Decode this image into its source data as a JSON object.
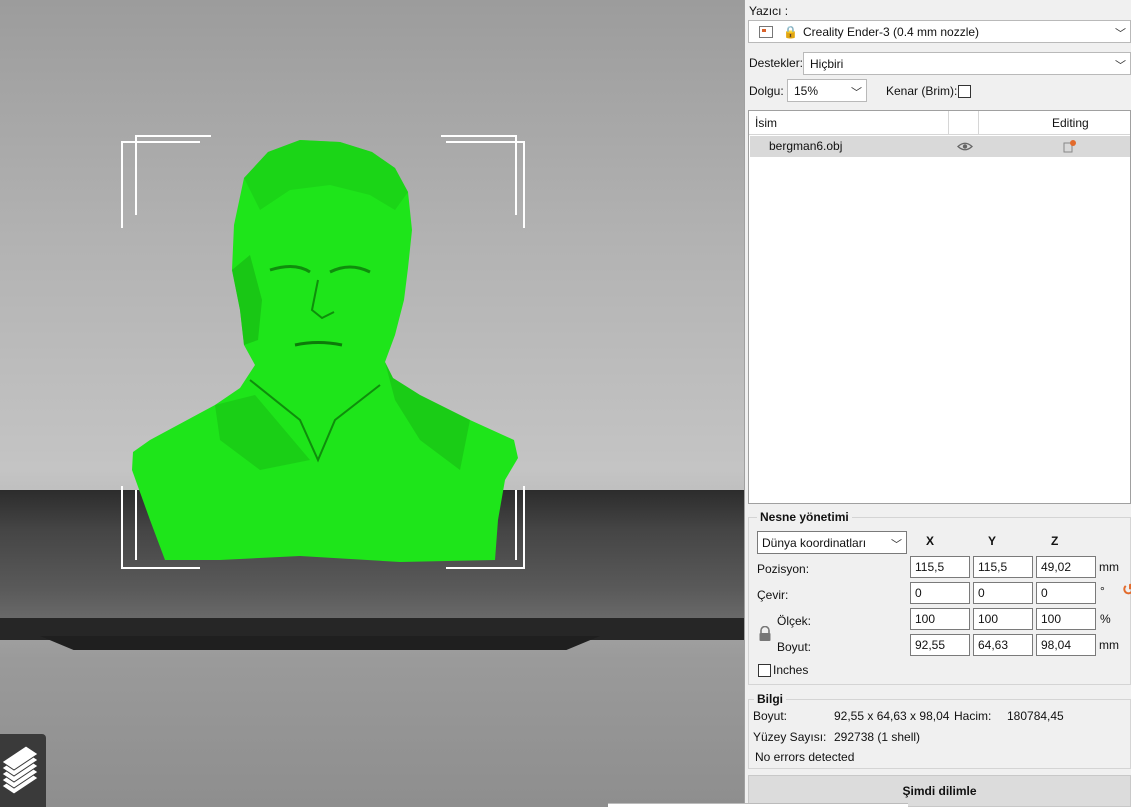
{
  "viewport": {
    "model_color": "#1ee51a"
  },
  "printer": {
    "label": "Yazıcı :",
    "value": "Creality Ender-3 (0.4 mm nozzle)"
  },
  "supports": {
    "label": "Destekler:",
    "value": "Hiçbiri"
  },
  "infill": {
    "label": "Dolgu:",
    "value": "15%"
  },
  "brim": {
    "label": "Kenar (Brim):"
  },
  "object_list": {
    "col_name": "İsim",
    "col_editing": "Editing",
    "rows": [
      {
        "name": "bergman6.obj"
      }
    ]
  },
  "object_manipulation": {
    "title": "Nesne yönetimi",
    "coord_system": "Dünya koordinatları",
    "axes": [
      "X",
      "Y",
      "Z"
    ],
    "position": {
      "label": "Pozisyon:",
      "x": "115,5",
      "y": "115,5",
      "z": "49,02",
      "unit": "mm"
    },
    "rotation": {
      "label": "Çevir:",
      "x": "0",
      "y": "0",
      "z": "0",
      "unit": "°"
    },
    "scale": {
      "label": "Ölçek:",
      "x": "100",
      "y": "100",
      "z": "100",
      "unit": "%"
    },
    "size": {
      "label": "Boyut:",
      "x": "92,55",
      "y": "64,63",
      "z": "98,04",
      "unit": "mm"
    },
    "inches_label": "Inches"
  },
  "info": {
    "title": "Bilgi",
    "size_label": "Boyut:",
    "size_value": "92,55 x 64,63 x 98,04",
    "volume_label": "Hacim:",
    "volume_value": "180784,45",
    "facets_label": "Yüzey Sayısı:",
    "facets_value": "292738 (1 shell)",
    "errors": "No errors detected"
  },
  "slice_button": "Şimdi dilimle"
}
